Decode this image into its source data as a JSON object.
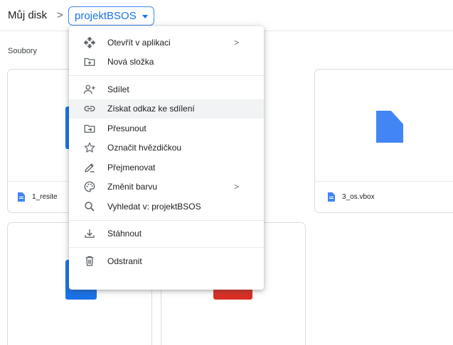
{
  "breadcrumb": {
    "root": "Můj disk",
    "separator": ">",
    "current": "projektBSOS"
  },
  "section_label": "Soubory",
  "files": [
    {
      "name": "1_resite",
      "type": "document",
      "color": "#4285f4"
    },
    {
      "name": "3_os.vbox",
      "type": "document",
      "color": "#4285f4"
    }
  ],
  "context_menu": {
    "groups": [
      [
        {
          "label": "Otevřít v aplikaci",
          "icon": "open-with-icon",
          "submenu": true
        },
        {
          "label": "Nová složka",
          "icon": "new-folder-icon",
          "submenu": false
        }
      ],
      [
        {
          "label": "Sdílet",
          "icon": "share-person-icon",
          "submenu": false
        },
        {
          "label": "Získat odkaz ke sdílení",
          "icon": "link-icon",
          "submenu": false,
          "highlighted": true
        },
        {
          "label": "Přesunout",
          "icon": "move-folder-icon",
          "submenu": false
        },
        {
          "label": "Označit hvězdičkou",
          "icon": "star-icon",
          "submenu": false
        },
        {
          "label": "Přejmenovat",
          "icon": "pencil-icon",
          "submenu": false
        },
        {
          "label": "Změnit barvu",
          "icon": "palette-icon",
          "submenu": true
        },
        {
          "label": "Vyhledat v: projektBSOS",
          "icon": "search-icon",
          "submenu": false
        }
      ],
      [
        {
          "label": "Stáhnout",
          "icon": "download-icon",
          "submenu": false
        }
      ],
      [
        {
          "label": "Odstranit",
          "icon": "trash-icon",
          "submenu": false
        }
      ]
    ],
    "submenu_chevron": ">"
  },
  "colors": {
    "accent": "#1a73e8",
    "doc_blue": "#4285f4",
    "thumb_red": "#d93025",
    "hover_bg": "#f1f3f4",
    "icon_gray": "#5f6368"
  }
}
